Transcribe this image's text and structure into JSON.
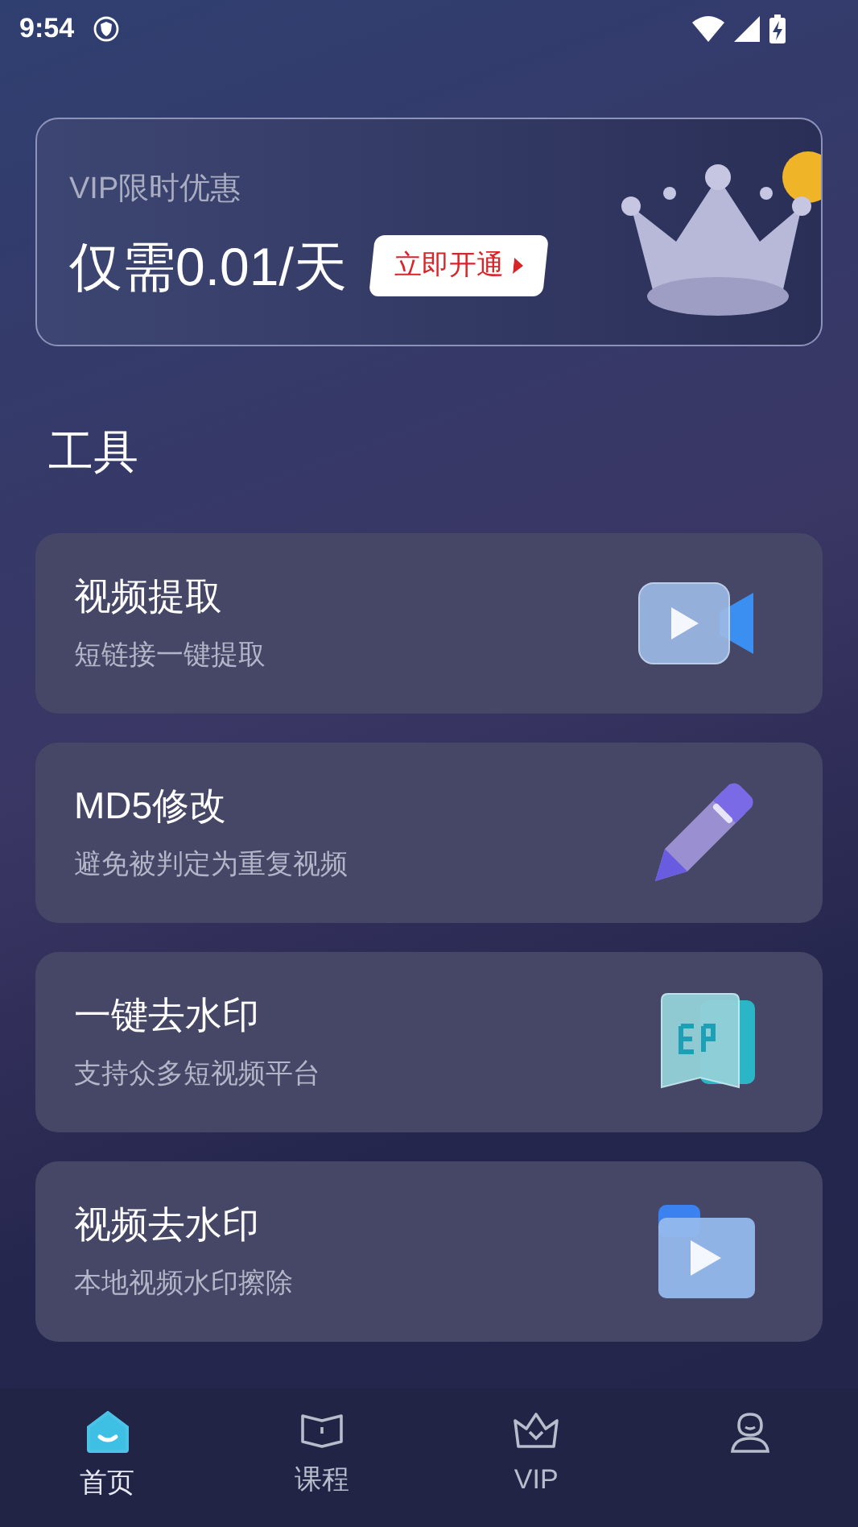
{
  "status_bar": {
    "time": "9:54"
  },
  "vip_banner": {
    "label": "VIP限时优惠",
    "price": "仅需0.01/天",
    "button": "立即开通"
  },
  "section_title": "工具",
  "tools": [
    {
      "kind": "video",
      "title": "视频提取",
      "subtitle": "短链接一键提取"
    },
    {
      "kind": "pen",
      "title": "MD5修改",
      "subtitle": "避免被判定为重复视频"
    },
    {
      "kind": "stamp",
      "title": "一键去水印",
      "subtitle": "支持众多短视频平台"
    },
    {
      "kind": "folder",
      "title": "视频去水印",
      "subtitle": "本地视频水印擦除"
    }
  ],
  "tab_bar": [
    {
      "kind": "home",
      "label": "首页",
      "selected": true
    },
    {
      "kind": "book",
      "label": "课程",
      "selected": false
    },
    {
      "kind": "crown",
      "label": "VIP",
      "selected": false
    },
    {
      "kind": "person",
      "selected": false
    }
  ]
}
